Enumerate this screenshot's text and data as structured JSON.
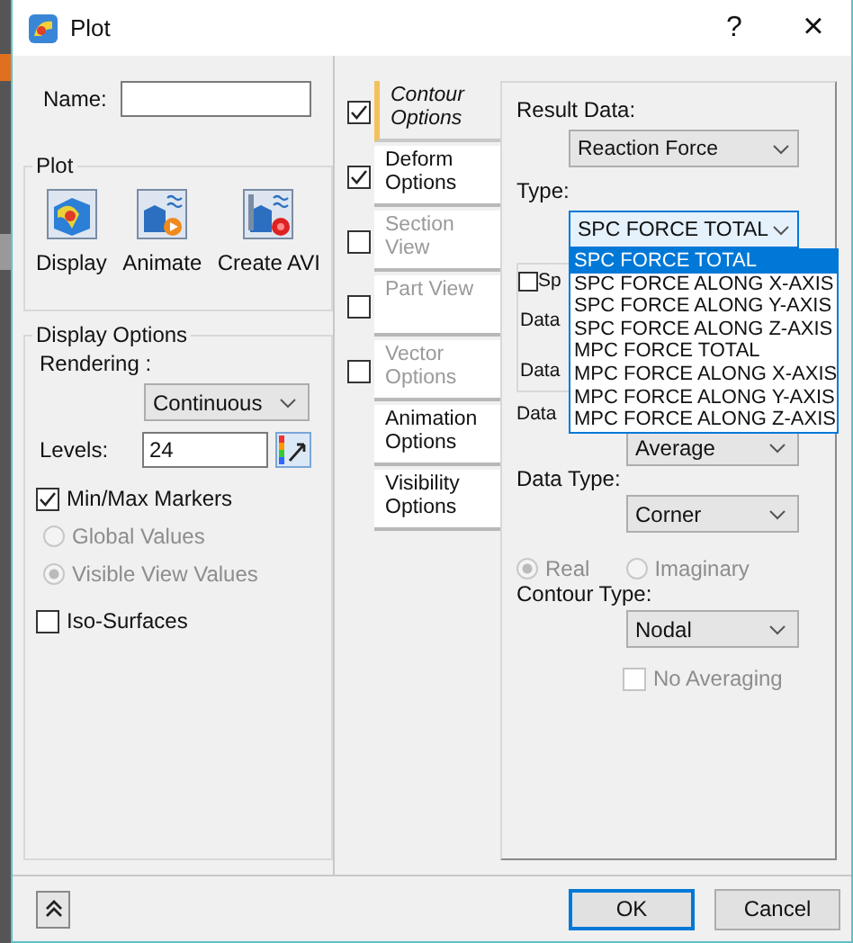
{
  "window": {
    "title": "Plot",
    "help": "?",
    "close": "×"
  },
  "name_field": {
    "label": "Name:"
  },
  "plot_group": {
    "title": "Plot",
    "buttons": [
      {
        "label": "Display",
        "kind": "display"
      },
      {
        "label": "Animate",
        "kind": "animate"
      },
      {
        "label": "Create AVI",
        "kind": "avi"
      }
    ]
  },
  "display_options": {
    "title": "Display Options",
    "rendering": {
      "label": "Rendering :",
      "value": "Continuous"
    },
    "levels": {
      "label": "Levels:",
      "value": "24"
    },
    "min_max_markers": {
      "label": "Min/Max Markers",
      "checked": true
    },
    "marker_values": [
      {
        "label": "Global Values",
        "selected": false,
        "disabled": true
      },
      {
        "label": "Visible View Values",
        "selected": true,
        "disabled": true
      }
    ],
    "iso_surfaces": {
      "label": "Iso-Surfaces",
      "checked": false
    }
  },
  "tabs": [
    {
      "label": "Contour Options",
      "selected": true,
      "disabled": false,
      "checked": true
    },
    {
      "label": "Deform Options",
      "selected": false,
      "disabled": false,
      "checked": true
    },
    {
      "label": "Section View",
      "selected": false,
      "disabled": true,
      "checked": false
    },
    {
      "label": "Part View",
      "selected": false,
      "disabled": true,
      "checked": false
    },
    {
      "label": "Vector Options",
      "selected": false,
      "disabled": true,
      "checked": false
    },
    {
      "label": "Animation Options",
      "selected": false,
      "disabled": false
    },
    {
      "label": "Visibility Options",
      "selected": false,
      "disabled": false
    }
  ],
  "contour": {
    "result_data": {
      "label": "Result Data:",
      "value": "Reaction Force"
    },
    "type": {
      "label": "Type:",
      "value": "SPC FORCE TOTAL",
      "expanded": true,
      "options": [
        {
          "label": "SPC FORCE TOTAL",
          "selected": true
        },
        {
          "label": "SPC FORCE ALONG X-AXIS",
          "selected": false
        },
        {
          "label": "SPC FORCE ALONG Y-AXIS",
          "selected": false
        },
        {
          "label": "SPC FORCE ALONG Z-AXIS",
          "selected": false
        },
        {
          "label": "MPC FORCE TOTAL",
          "selected": false
        },
        {
          "label": "MPC FORCE ALONG X-AXIS",
          "selected": false
        },
        {
          "label": "MPC FORCE ALONG Y-AXIS",
          "selected": false
        },
        {
          "label": "MPC FORCE ALONG Z-AXIS",
          "selected": false
        }
      ]
    },
    "covered": {
      "checkbox_label": "Sp",
      "checked": false,
      "label_1": "Data",
      "label_2": "Data"
    },
    "averaging": {
      "label": "Data",
      "value": "Average"
    },
    "data_type": {
      "label": "Data Type:",
      "value": "Corner"
    },
    "component": [
      {
        "label": "Real",
        "selected": true,
        "disabled": true
      },
      {
        "label": "Imaginary",
        "selected": false,
        "disabled": true
      }
    ],
    "contour_type": {
      "label": "Contour Type:",
      "value": "Nodal"
    },
    "no_averaging": {
      "label": "No Averaging",
      "checked": false,
      "disabled": true
    }
  },
  "buttons": [
    {
      "label": "OK",
      "kind": "ok"
    },
    {
      "label": "Cancel",
      "kind": "cancel"
    }
  ]
}
